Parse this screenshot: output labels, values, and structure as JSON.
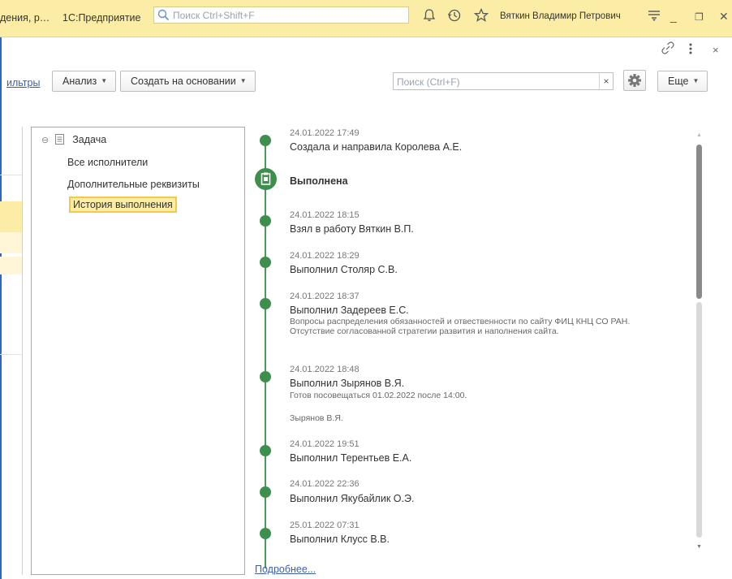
{
  "titlebar": {
    "doc_fragment": "дения, р…",
    "app_name": "1С:Предприятие",
    "search_placeholder": "Поиск Ctrl+Shift+F",
    "user_name": "Вяткин Владимир Петрович"
  },
  "toolbar": {
    "filters_link": "ильтры",
    "analysis_label": "Анализ",
    "create_based_label": "Создать на основании",
    "search_placeholder": "Поиск (Ctrl+F)",
    "clear_label": "×",
    "more_label": "Еще"
  },
  "tree": {
    "root_label": "Задача",
    "items": [
      {
        "label": "Все исполнители"
      },
      {
        "label": "Дополнительные реквизиты"
      },
      {
        "label": "История выполнения"
      }
    ]
  },
  "timeline": {
    "status_label": "Выполнена",
    "events": [
      {
        "date": "24.01.2022 17:49",
        "title": "Создала и направила Королева А.Е."
      },
      {
        "date": "24.01.2022 18:15",
        "title": "Взял в работу Вяткин В.П."
      },
      {
        "date": "24.01.2022 18:29",
        "title": "Выполнил Столяр С.В."
      },
      {
        "date": "24.01.2022 18:37",
        "title": "Выполнил Задереев Е.С.",
        "note": "Вопросы распределения обязанностей и отвественности по сайту ФИЦ КНЦ СО РАН. Отсутствие согласованной стратегии развития и наполнения сайта."
      },
      {
        "date": "24.01.2022 18:48",
        "title": "Выполнил Зырянов В.Я.",
        "note": "Готов посовещаться 01.02.2022 после 14:00.",
        "signature": "Зырянов В.Я."
      },
      {
        "date": "24.01.2022 19:51",
        "title": "Выполнил Терентьев Е.А."
      },
      {
        "date": "24.01.2022 22:36",
        "title": "Выполнил Якубайлик О.Э."
      },
      {
        "date": "25.01.2022 07:31",
        "title": "Выполнил Клусс В.В."
      }
    ],
    "more_link": "Подробнее..."
  },
  "colors": {
    "titlebar_bg": "#fbeda6",
    "accent_green": "#3e8e4e",
    "selection_border": "#f2c94c",
    "link_blue": "#3b5fa8"
  }
}
